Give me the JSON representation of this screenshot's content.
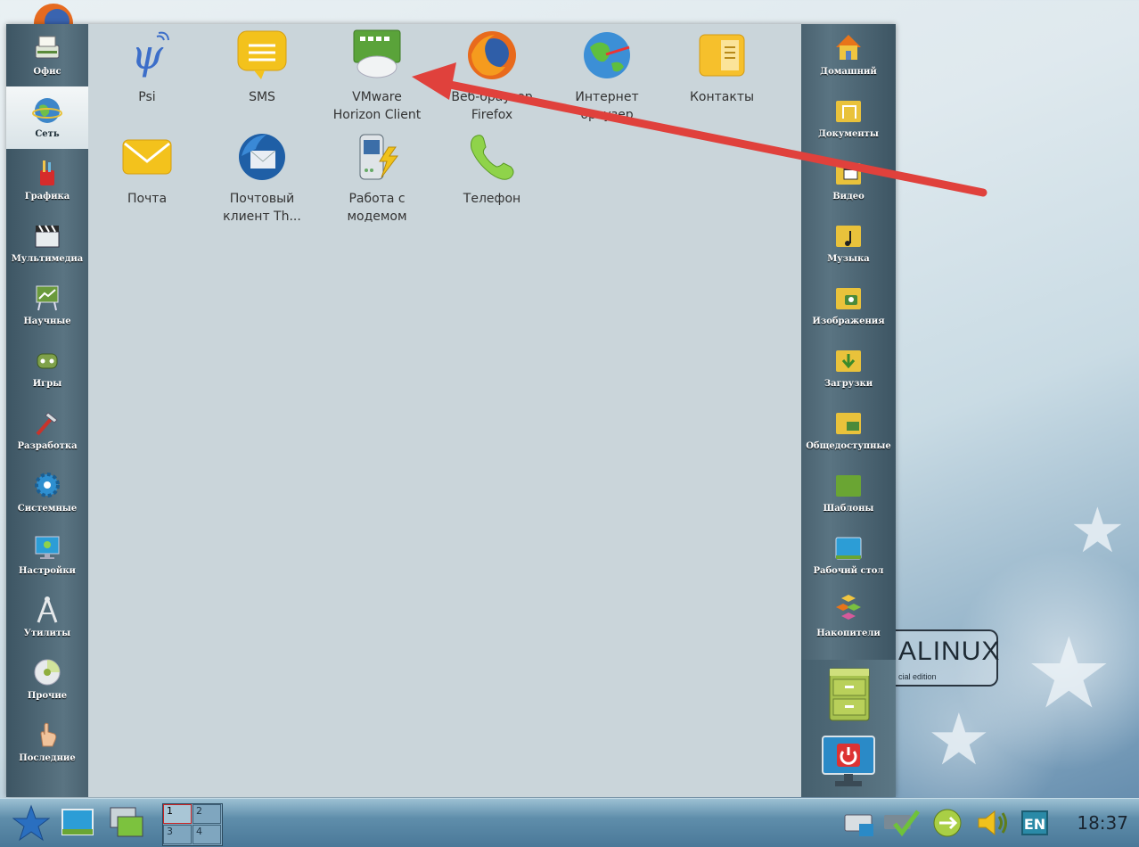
{
  "categories": [
    {
      "label": "Офис",
      "icon": "printer-icon"
    },
    {
      "label": "Сеть",
      "icon": "globe-icon",
      "active": true
    },
    {
      "label": "Графика",
      "icon": "paint-brushes-icon"
    },
    {
      "label": "Мультимедиа",
      "icon": "clapperboard-icon"
    },
    {
      "label": "Научные",
      "icon": "chart-board-icon"
    },
    {
      "label": "Игры",
      "icon": "gamepad-icon"
    },
    {
      "label": "Разработка",
      "icon": "hammer-icon"
    },
    {
      "label": "Системные",
      "icon": "gear-icon"
    },
    {
      "label": "Настройки",
      "icon": "monitor-settings-icon"
    },
    {
      "label": "Утилиты",
      "icon": "compass-icon"
    },
    {
      "label": "Прочие",
      "icon": "disc-icon"
    },
    {
      "label": "Последние",
      "icon": "hand-pointer-icon"
    }
  ],
  "apps": [
    {
      "label": "Psi",
      "icon": "psi-icon"
    },
    {
      "label": "SMS",
      "icon": "sms-icon"
    },
    {
      "label": "VMware\nHorizon Client",
      "icon": "vmware-horizon-icon"
    },
    {
      "label": "Веб-браузер\nFirefox",
      "icon": "firefox-icon"
    },
    {
      "label": "Интернет\nбраузер",
      "icon": "internet-browser-icon"
    },
    {
      "label": "Контакты",
      "icon": "contacts-icon"
    },
    {
      "label": "Почта",
      "icon": "mail-envelope-icon"
    },
    {
      "label": "Почтовый\nклиент Th...",
      "icon": "thunderbird-icon"
    },
    {
      "label": "Работа с\nмодемом",
      "icon": "modem-icon"
    },
    {
      "label": "Телефон",
      "icon": "phone-icon"
    }
  ],
  "places": [
    {
      "label": "Домашний",
      "icon": "home-folder-icon"
    },
    {
      "label": "Документы",
      "icon": "documents-folder-icon"
    },
    {
      "label": "Видео",
      "icon": "video-folder-icon"
    },
    {
      "label": "Музыка",
      "icon": "music-folder-icon"
    },
    {
      "label": "Изображения",
      "icon": "pictures-folder-icon"
    },
    {
      "label": "Загрузки",
      "icon": "downloads-folder-icon"
    },
    {
      "label": "Общедоступные",
      "icon": "public-folder-icon"
    },
    {
      "label": "Шаблоны",
      "icon": "templates-folder-icon"
    },
    {
      "label": "Рабочий стол",
      "icon": "desktop-folder-icon"
    },
    {
      "label": "Накопители",
      "icon": "drives-icon"
    }
  ],
  "panel_actions": [
    {
      "icon": "file-cabinet-icon"
    },
    {
      "icon": "power-off-icon"
    }
  ],
  "desktop": {
    "brand": "ALINUX",
    "brand_sub": "cial edition"
  },
  "taskbar": {
    "pager": [
      "1",
      "2",
      "3",
      "4"
    ],
    "active_desktop": "1",
    "lang": "EN",
    "clock": "18:37"
  },
  "colors": {
    "annotation_arrow": "#e0413c"
  }
}
